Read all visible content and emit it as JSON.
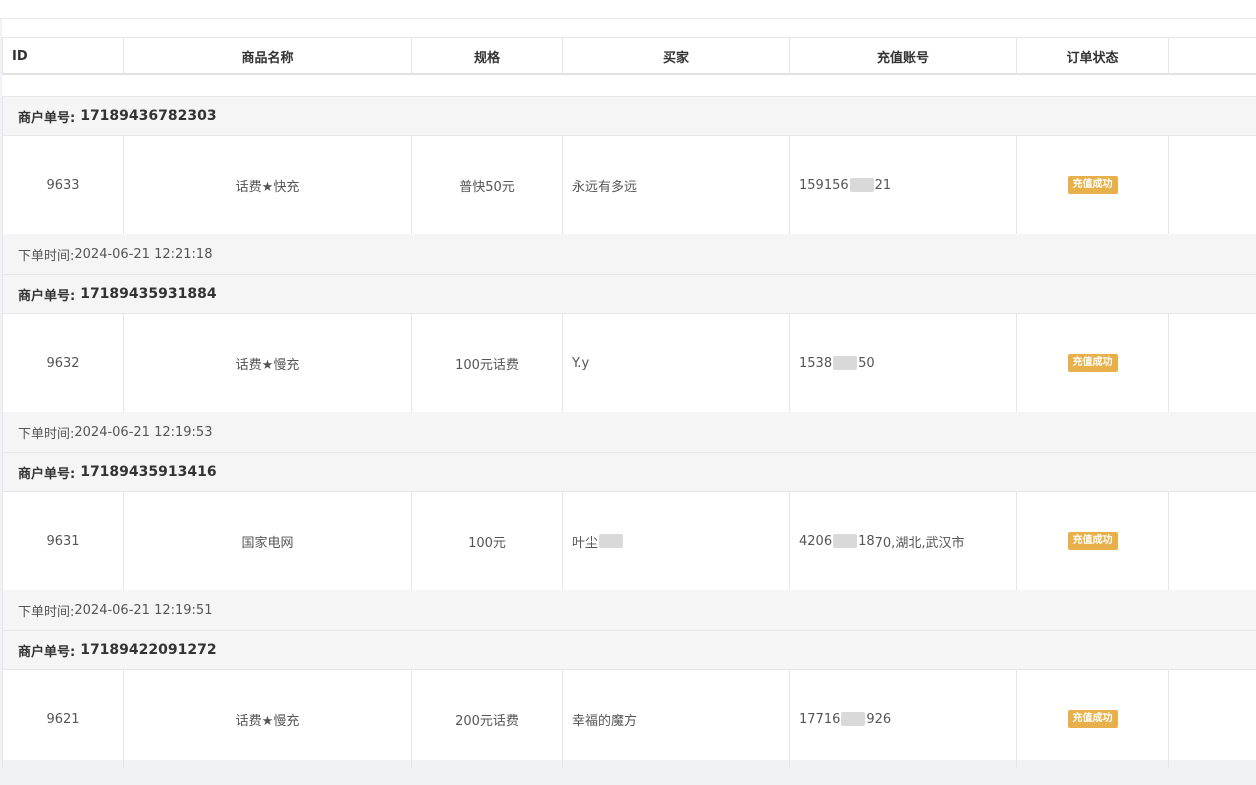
{
  "columns": {
    "id": "ID",
    "product": "商品名称",
    "spec": "规格",
    "buyer": "买家",
    "account": "充值账号",
    "status": "订单状态"
  },
  "labels": {
    "merchant_no": "商户单号:",
    "order_time": "下单时间:"
  },
  "orders": [
    {
      "merchant_no": "17189436782303",
      "id": "9633",
      "product": "话费★快充",
      "spec": "普快50元",
      "buyer": "永远有多远",
      "account_prefix": "159156",
      "account_suffix": "21",
      "status": "充值成功",
      "order_time": "2024-06-21 12:21:18"
    },
    {
      "merchant_no": "17189435931884",
      "id": "9632",
      "product": "话费★慢充",
      "spec": "100元话费",
      "buyer": "Y.y",
      "account_prefix": "1538",
      "account_suffix": "50",
      "status": "充值成功",
      "order_time": "2024-06-21 12:19:53"
    },
    {
      "merchant_no": "17189435913416",
      "id": "9631",
      "product": "国家电网",
      "spec": "100元",
      "buyer": "叶尘",
      "account_prefix": "4206",
      "account_suffix": "18",
      "account_extra": "70,湖北,武汉市",
      "status": "充值成功",
      "order_time": "2024-06-21 12:19:51"
    },
    {
      "merchant_no": "17189422091272",
      "id": "9621",
      "product": "话费★慢充",
      "spec": "200元话费",
      "buyer": "幸福的魔方",
      "account_prefix": "17716",
      "account_suffix": "926",
      "status": "充值成功"
    }
  ]
}
